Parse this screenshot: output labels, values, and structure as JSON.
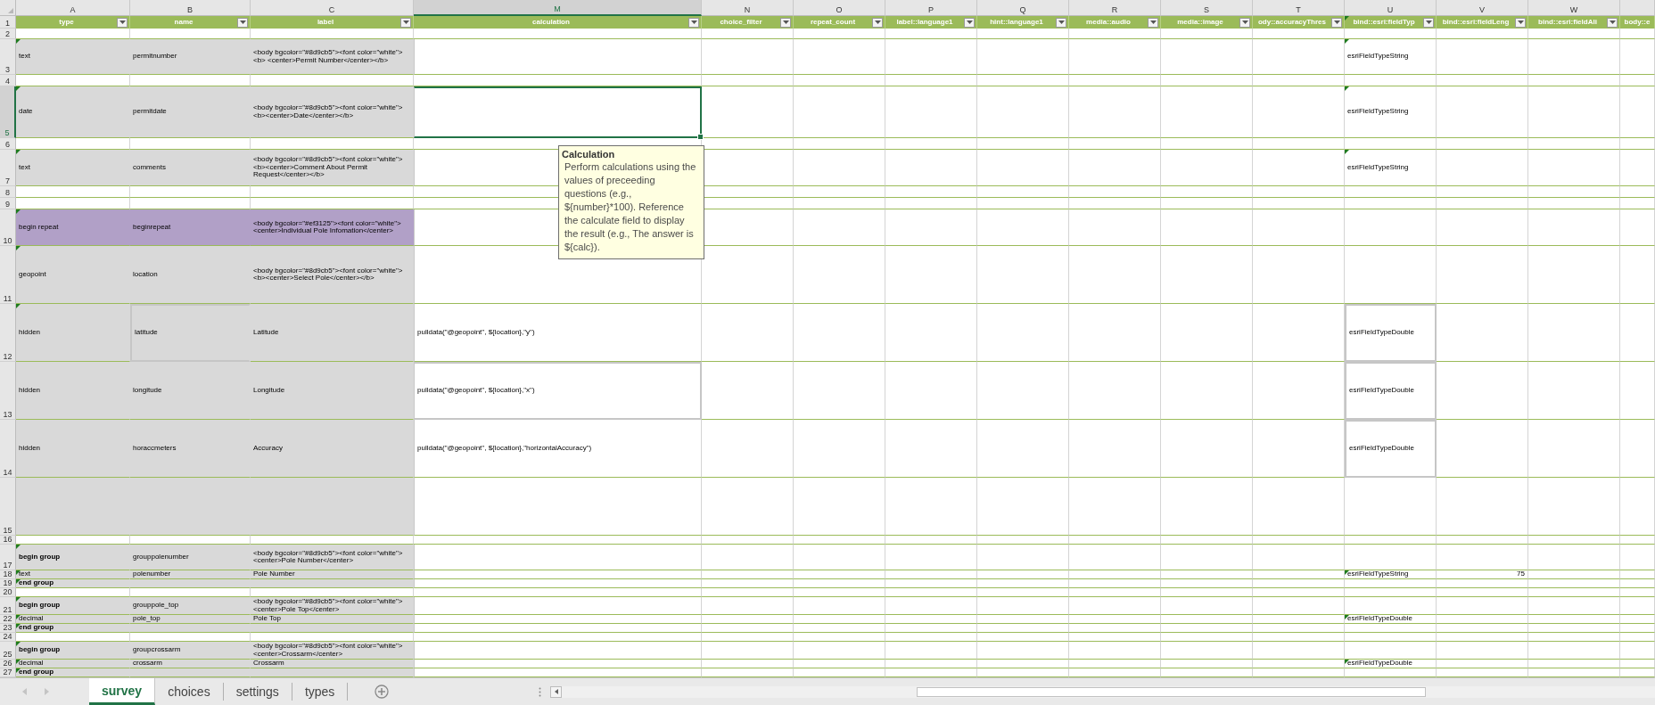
{
  "title_row_number": "1",
  "columns": [
    {
      "letter": "A",
      "title": "type",
      "selected": false
    },
    {
      "letter": "B",
      "title": "name",
      "selected": false
    },
    {
      "letter": "C",
      "title": "label",
      "selected": false
    },
    {
      "letter": "M",
      "title": "calculation",
      "selected": true
    },
    {
      "letter": "N",
      "title": "choice_filter",
      "selected": false
    },
    {
      "letter": "O",
      "title": "repeat_count",
      "selected": false
    },
    {
      "letter": "P",
      "title": "label::language1",
      "selected": false
    },
    {
      "letter": "Q",
      "title": "hint::language1",
      "selected": false
    },
    {
      "letter": "R",
      "title": "media::audio",
      "selected": false
    },
    {
      "letter": "S",
      "title": "media::image",
      "selected": false
    },
    {
      "letter": "T",
      "title": "ody::accuracyThres",
      "selected": false
    },
    {
      "letter": "U",
      "title": "bind::esri:fieldTyp",
      "selected": false,
      "flagged": true
    },
    {
      "letter": "V",
      "title": "bind::esri:fieldLeng",
      "selected": false
    },
    {
      "letter": "W",
      "title": "bind::esri:fieldAli",
      "selected": false
    },
    {
      "title": "body::e",
      "selected": false
    }
  ],
  "rows": [
    {
      "number": "2",
      "kind": "blank",
      "selected": false
    },
    {
      "number": "3",
      "kind": "filled",
      "selected": false,
      "type_flag": true,
      "field_type_flag": true,
      "cells": {
        "A": "text",
        "B": "permitnumber",
        "C": "<body bgcolor=\"#8d9cb5\"><font color=\"white\"><b> <center>Permit Number</center></b>",
        "U": "esriFieldTypeString"
      }
    },
    {
      "number": "4",
      "kind": "blank",
      "selected": false
    },
    {
      "number": "5",
      "kind": "filled",
      "selected": true,
      "type_flag": true,
      "field_type_flag": true,
      "cells": {
        "A": "date",
        "B": "permitdate",
        "C": "<body bgcolor=\"#8d9cb5\"><font color=\"white\"><b><center>Date</center></b>",
        "U": "esriFieldTypeString"
      }
    },
    {
      "number": "6",
      "kind": "blank",
      "selected": false
    },
    {
      "number": "7",
      "kind": "filled",
      "selected": false,
      "type_flag": true,
      "field_type_flag": true,
      "cells": {
        "A": "text",
        "B": "comments",
        "C": "<body bgcolor=\"#8d9cb5\"><font color=\"white\"><b><center>Comment About Permit Request</center></b>",
        "U": "esriFieldTypeString"
      }
    },
    {
      "number": "8",
      "kind": "blank",
      "selected": false
    },
    {
      "number": "9",
      "kind": "blank",
      "selected": false
    },
    {
      "number": "10",
      "kind": "repeat",
      "selected": false,
      "type_flag": true,
      "cells": {
        "A": "begin repeat",
        "B": "beginrepeat",
        "C": "<body bgcolor=\"#ef3125\"><font color=\"white\"><center>Individual Pole Infomation</center>"
      }
    },
    {
      "number": "11",
      "kind": "filled",
      "selected": false,
      "type_flag": true,
      "cells": {
        "A": "geopoint",
        "B": "location",
        "C": "<body bgcolor=\"#8d9cb5\"><font color=\"white\"><b><center>Select Pole</center></b>"
      }
    },
    {
      "number": "12",
      "kind": "filled",
      "selected": false,
      "type_flag": true,
      "name_outlined": true,
      "field_type_outlined": true,
      "cells": {
        "A": "hidden",
        "B": "latitude",
        "C": "Latitude",
        "M": "pulldata(\"@geopoint\", ${location},\"y\")",
        "U": "esriFieldTypeDouble"
      }
    },
    {
      "number": "13",
      "kind": "filled",
      "selected": false,
      "calc_outlined": true,
      "field_type_outlined": true,
      "cells": {
        "A": "hidden",
        "B": "longitude",
        "C": "Longitude",
        "M": "pulldata(\"@geopoint\", ${location},\"x\")",
        "U": "esriFieldTypeDouble"
      }
    },
    {
      "number": "14",
      "kind": "filled",
      "selected": false,
      "field_type_outlined": true,
      "cells": {
        "A": "hidden",
        "B": "horaccmeters",
        "C": "Accuracy",
        "M": "pulldata(\"@geopoint\", ${location},\"horizontalAccuracy\")",
        "U": "esriFieldTypeDouble"
      }
    },
    {
      "number": "15",
      "kind": "filled",
      "selected": false
    },
    {
      "number": "16",
      "kind": "blank",
      "selected": false
    },
    {
      "number": "17",
      "kind": "filled",
      "selected": false,
      "bold": true,
      "type_flag": true,
      "cells": {
        "A": "begin group",
        "B": "grouppolenumber",
        "C": "<body bgcolor=\"#8d9cb5\"><font color=\"white\"><center>Pole Number</center>"
      }
    },
    {
      "number": "18",
      "kind": "filled",
      "selected": false,
      "type_flag": true,
      "field_type_flag": true,
      "cells": {
        "A": "text",
        "B": "polenumber",
        "C": "Pole Number",
        "U": "esriFieldTypeString",
        "V": "75"
      }
    },
    {
      "number": "19",
      "kind": "filled",
      "selected": false,
      "bold": true,
      "type_flag": true,
      "cells": {
        "A": "end group"
      }
    },
    {
      "number": "20",
      "kind": "blank",
      "selected": false
    },
    {
      "number": "21",
      "kind": "filled",
      "selected": false,
      "bold": true,
      "type_flag": true,
      "cells": {
        "A": "begin group",
        "B": "grouppole_top",
        "C": "<body bgcolor=\"#8d9cb5\"><font color=\"white\"><center>Pole Top</center>"
      }
    },
    {
      "number": "22",
      "kind": "filled",
      "selected": false,
      "type_flag": true,
      "field_type_flag": true,
      "cells": {
        "A": "decimal",
        "B": "pole_top",
        "C": "Pole Top",
        "U": "esriFieldTypeDouble"
      }
    },
    {
      "number": "23",
      "kind": "filled",
      "selected": false,
      "bold": true,
      "type_flag": true,
      "cells": {
        "A": "end group"
      }
    },
    {
      "number": "24",
      "kind": "blank",
      "selected": false
    },
    {
      "number": "25",
      "kind": "filled",
      "selected": false,
      "bold": true,
      "type_flag": true,
      "cells": {
        "A": "begin group",
        "B": "groupcrossarm",
        "C": "<body bgcolor=\"#8d9cb5\"><font color=\"white\"><center>Crossarm</center>"
      }
    },
    {
      "number": "26",
      "kind": "filled",
      "selected": false,
      "type_flag": true,
      "field_type_flag": true,
      "cells": {
        "A": "decimal",
        "B": "crossarm",
        "C": "Crossarm",
        "U": "esriFieldTypeDouble"
      }
    },
    {
      "number": "27",
      "kind": "filled",
      "selected": false,
      "bold": true,
      "type_flag": true,
      "cells": {
        "A": "end group"
      }
    }
  ],
  "tooltip": {
    "title": "Calculation",
    "text": "Perform calculations using the values of preceeding questions (e.g., ${number}*100). Reference the calculate field to display the result (e.g., The answer is ${calc})."
  },
  "sheet_tabs": [
    {
      "label": "survey",
      "selected": true
    },
    {
      "label": "choices",
      "selected": false
    },
    {
      "label": "settings",
      "selected": false
    },
    {
      "label": "types",
      "selected": false
    }
  ]
}
